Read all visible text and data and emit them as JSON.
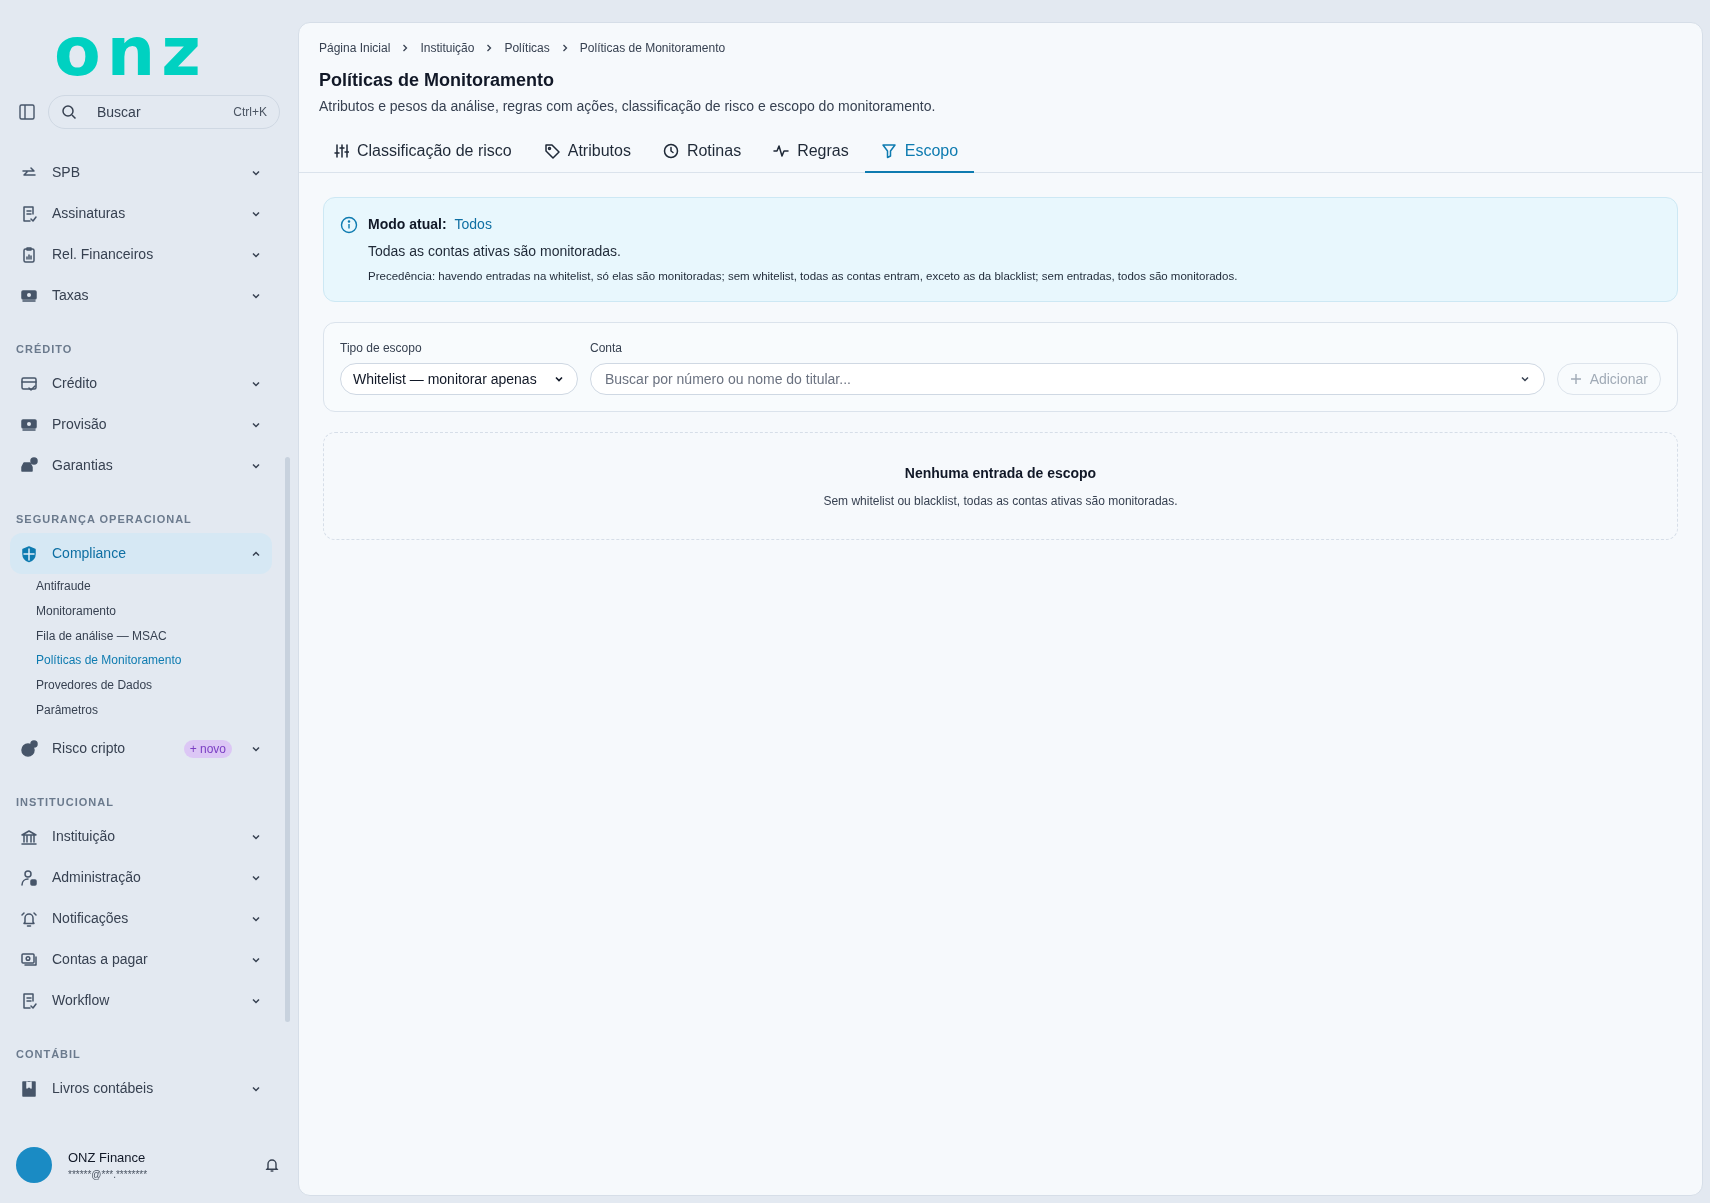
{
  "logo": "onz",
  "search": {
    "placeholder": "Buscar",
    "shortcut": "Ctrl+K"
  },
  "sidebar": {
    "sections": [
      {
        "items": [
          {
            "label": "SPB",
            "selected": false,
            "expanded": false
          },
          {
            "label": "Assinaturas",
            "selected": false,
            "expanded": false
          },
          {
            "label": "Rel. Financeiros",
            "selected": false,
            "expanded": false
          },
          {
            "label": "Taxas",
            "selected": false,
            "expanded": false
          }
        ]
      },
      {
        "heading": "CRÉDITO",
        "items": [
          {
            "label": "Crédito",
            "selected": false,
            "expanded": false
          },
          {
            "label": "Provisão",
            "selected": false,
            "expanded": false
          },
          {
            "label": "Garantias",
            "selected": false,
            "expanded": false
          }
        ]
      },
      {
        "heading": "SEGURANÇA OPERACIONAL",
        "items": [
          {
            "label": "Compliance",
            "selected": true,
            "expanded": true,
            "children": [
              {
                "label": "Antifraude",
                "selected": false
              },
              {
                "label": "Monitoramento",
                "selected": false
              },
              {
                "label": "Fila de análise — MSAC",
                "selected": false
              },
              {
                "label": "Políticas de Monitoramento",
                "selected": true
              },
              {
                "label": "Provedores de Dados",
                "selected": false
              },
              {
                "label": "Parâmetros",
                "selected": false
              }
            ]
          },
          {
            "label": "Risco cripto",
            "selected": false,
            "expanded": false,
            "badge": "+ novo"
          }
        ]
      },
      {
        "heading": "INSTITUCIONAL",
        "items": [
          {
            "label": "Instituição",
            "selected": false,
            "expanded": false
          },
          {
            "label": "Administração",
            "selected": false,
            "expanded": false
          },
          {
            "label": "Notificações",
            "selected": false,
            "expanded": false
          },
          {
            "label": "Contas a pagar",
            "selected": false,
            "expanded": false
          },
          {
            "label": "Workflow",
            "selected": false,
            "expanded": false
          }
        ]
      },
      {
        "heading": "CONTÁBIL",
        "items": [
          {
            "label": "Livros contábeis",
            "selected": false,
            "expanded": false
          }
        ]
      }
    ]
  },
  "user": {
    "name": "ONZ Finance",
    "email": "******@***.********"
  },
  "breadcrumb": [
    "Página Inicial",
    "Instituição",
    "Políticas",
    "Políticas de Monitoramento"
  ],
  "title": "Políticas de Monitoramento",
  "description": "Atributos e pesos da análise, regras com ações, classificação de risco e escopo do monitoramento.",
  "tabs": [
    {
      "label": "Classificação de risco",
      "selected": false
    },
    {
      "label": "Atributos",
      "selected": false
    },
    {
      "label": "Rotinas",
      "selected": false
    },
    {
      "label": "Regras",
      "selected": false
    },
    {
      "label": "Escopo",
      "selected": true
    }
  ],
  "info": {
    "mode_label": "Modo atual:",
    "mode_value": "Todos",
    "summary": "Todas as contas ativas são monitoradas.",
    "note": "Precedência: havendo entradas na whitelist, só elas são monitoradas; sem whitelist, todas as contas entram, exceto as da blacklist; sem entradas, todos são monitorados."
  },
  "form": {
    "scope_label": "Tipo de escopo",
    "scope_value": "Whitelist — monitorar apenas",
    "account_label": "Conta",
    "account_placeholder": "Buscar por número ou nome do titular...",
    "add_button": {
      "label": "Adicionar",
      "disabled": true
    }
  },
  "empty": {
    "title": "Nenhuma entrada de escopo",
    "text": "Sem whitelist ou blacklist, todas as contas ativas são monitoradas."
  }
}
